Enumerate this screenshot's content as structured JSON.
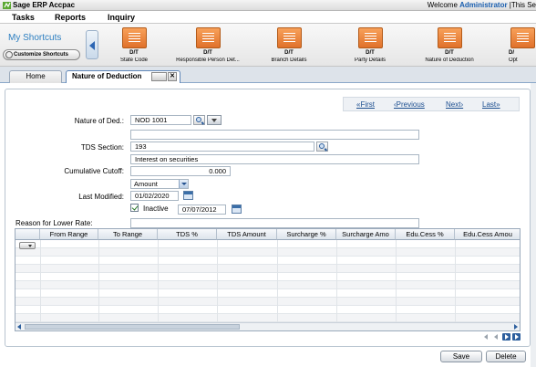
{
  "app": {
    "title": "Sage ERP Accpac",
    "welcome_prefix": "Welcome ",
    "user": "Administrator",
    "welcome_suffix": " |This Se"
  },
  "menu": [
    "Tasks",
    "Reports",
    "Inquiry"
  ],
  "shortcuts": {
    "title": "My Shortcuts",
    "customize_label": "Customize Shortcuts",
    "items": [
      {
        "code": "D/T",
        "label": "State Code"
      },
      {
        "code": "D/T",
        "label": "Responsible Person Det..."
      },
      {
        "code": "D/T",
        "label": "Branch Details"
      },
      {
        "code": "D/T",
        "label": "Party Details"
      },
      {
        "code": "D/T",
        "label": "Nature of Deduction"
      },
      {
        "code": "D/",
        "label": "Opt"
      }
    ]
  },
  "tabs": {
    "home": "Home",
    "active": "Nature of Deduction"
  },
  "record_nav": {
    "first": "«First",
    "previous": "‹Previous",
    "next": "Next›",
    "last": "Last»"
  },
  "form": {
    "nature_label": "Nature of Ded.:",
    "nature_value": "NOD 1001",
    "nature_desc": "",
    "tds_label": "TDS Section:",
    "tds_value": "193",
    "tds_desc": "Interest on securities",
    "cutoff_label": "Cumulative Cutoff:",
    "cutoff_value": "0.000",
    "cutoff_type": "Amount",
    "last_modified_label": "Last Modified:",
    "last_modified_value": "01/02/2020",
    "inactive_label": "Inactive",
    "inactive_checked": true,
    "inactive_date": "07/07/2012",
    "reason_label": "Reason for Lower Rate:",
    "reason_value": ""
  },
  "grid": {
    "columns": [
      "From Range",
      "To Range",
      "TDS %",
      "TDS Amount",
      "Surcharge %",
      "Surcharge Amo",
      "Edu.Cess %",
      "Edu.Cess Amou"
    ]
  },
  "buttons": {
    "save": "Save",
    "delete": "Delete"
  },
  "colors": {
    "accent": "#2d7fc1",
    "shortcut_icon": "#e0712b",
    "link": "#1a4d8f"
  }
}
